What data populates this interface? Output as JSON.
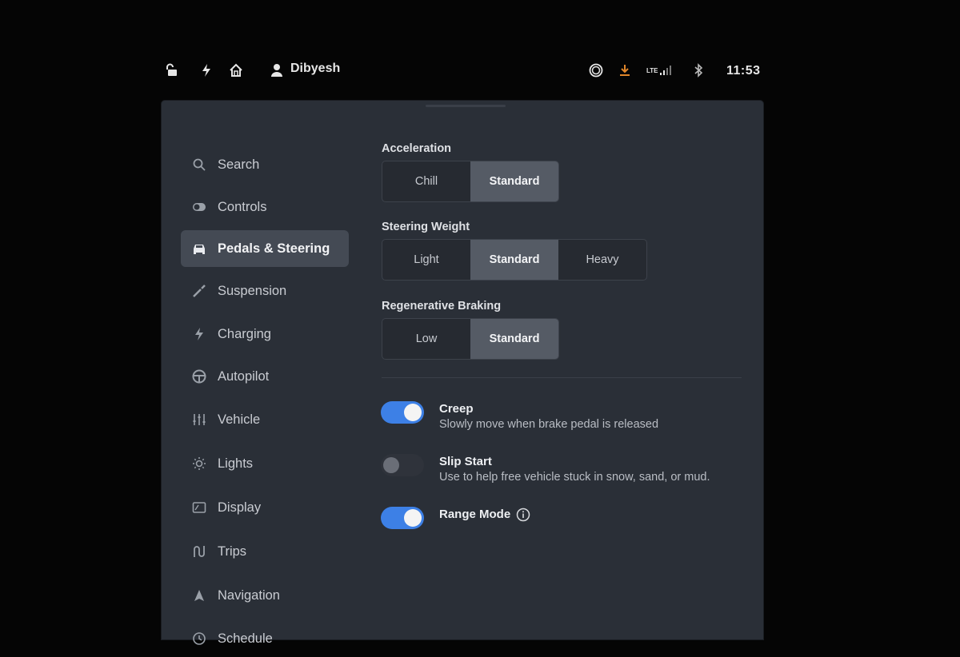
{
  "status_bar": {
    "user_name": "Dibyesh",
    "network": "LTE",
    "time": "11:53",
    "icons": [
      "lock-open-icon",
      "bolt-icon",
      "homelink-icon",
      "user-icon",
      "dashcam-icon",
      "download-icon",
      "signal-icon",
      "bluetooth-icon"
    ],
    "download_color": "#e0862a"
  },
  "sidebar": {
    "items": [
      {
        "label": "Search",
        "icon": "search-icon"
      },
      {
        "label": "Controls",
        "icon": "toggle-icon"
      },
      {
        "label": "Pedals & Steering",
        "icon": "car-icon",
        "active": true
      },
      {
        "label": "Suspension",
        "icon": "suspension-icon"
      },
      {
        "label": "Charging",
        "icon": "bolt-icon"
      },
      {
        "label": "Autopilot",
        "icon": "steering-wheel-icon"
      },
      {
        "label": "Vehicle",
        "icon": "sliders-icon"
      },
      {
        "label": "Lights",
        "icon": "sun-icon"
      },
      {
        "label": "Display",
        "icon": "display-icon"
      },
      {
        "label": "Trips",
        "icon": "trips-icon"
      },
      {
        "label": "Navigation",
        "icon": "navigation-icon"
      },
      {
        "label": "Schedule",
        "icon": "clock-icon"
      }
    ]
  },
  "acceleration": {
    "title": "Acceleration",
    "options": [
      "Chill",
      "Standard"
    ],
    "selected": "Standard"
  },
  "steering_weight": {
    "title": "Steering Weight",
    "options": [
      "Light",
      "Standard",
      "Heavy"
    ],
    "selected": "Standard"
  },
  "regen_braking": {
    "title": "Regenerative Braking",
    "options": [
      "Low",
      "Standard"
    ],
    "selected": "Standard"
  },
  "toggles": {
    "creep": {
      "title": "Creep",
      "desc": "Slowly move when brake pedal is released",
      "on": true
    },
    "slip_start": {
      "title": "Slip Start",
      "desc": "Use to help free vehicle stuck in snow, sand, or mud.",
      "on": false
    },
    "range_mode": {
      "title": "Range Mode",
      "on": true
    }
  },
  "colors": {
    "accent": "#3d80e6",
    "panel": "#2a2f37",
    "selected_segment": "#555b65"
  }
}
